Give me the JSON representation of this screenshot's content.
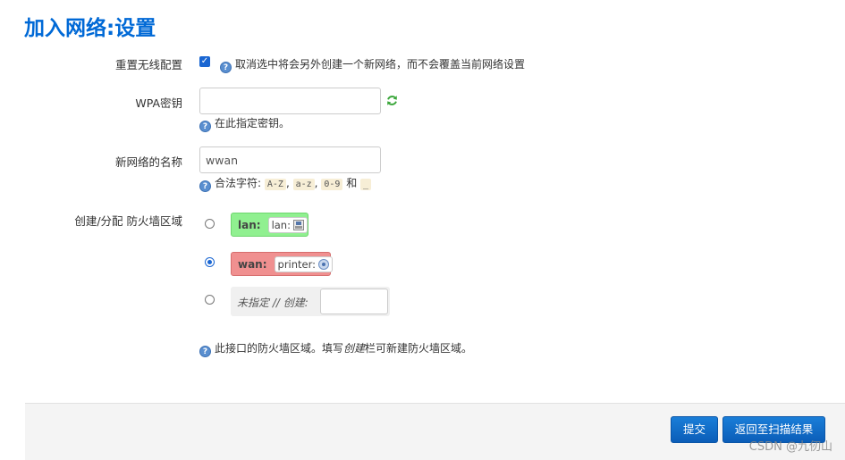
{
  "page": {
    "title": "加入网络:设置"
  },
  "reset_wireless": {
    "label": "重置无线配置",
    "checked": true,
    "help": "取消选中将会另外创建一个新网络，而不会覆盖当前网络设置"
  },
  "wpa_key": {
    "label": "WPA密钥",
    "value": "",
    "help": "在此指定密钥。"
  },
  "network_name": {
    "label": "新网络的名称",
    "value": "wwan",
    "help_prefix": "合法字符:",
    "chars": [
      "A-Z",
      "a-z",
      "0-9",
      "_"
    ],
    "separator": ",",
    "and_word": "和"
  },
  "firewall": {
    "label": "创建/分配 防火墙区域",
    "zones": [
      {
        "name": "lan:",
        "interface": "lan:",
        "color": "#90f090",
        "selected": false
      },
      {
        "name": "wan:",
        "interface": "printer:",
        "color": "#f09090",
        "selected": true
      }
    ],
    "unspecified_label": "未指定 // 创建:",
    "help_before": "此接口的防火墙区域。填写",
    "help_italic": "创建",
    "help_after": "栏可新建防火墙区域。"
  },
  "actions": {
    "submit": "提交",
    "back": "返回至扫描结果"
  },
  "watermark": "CSDN @九仞山",
  "colors": {
    "accent": "#0069d6",
    "button": "#1a7ed8"
  }
}
